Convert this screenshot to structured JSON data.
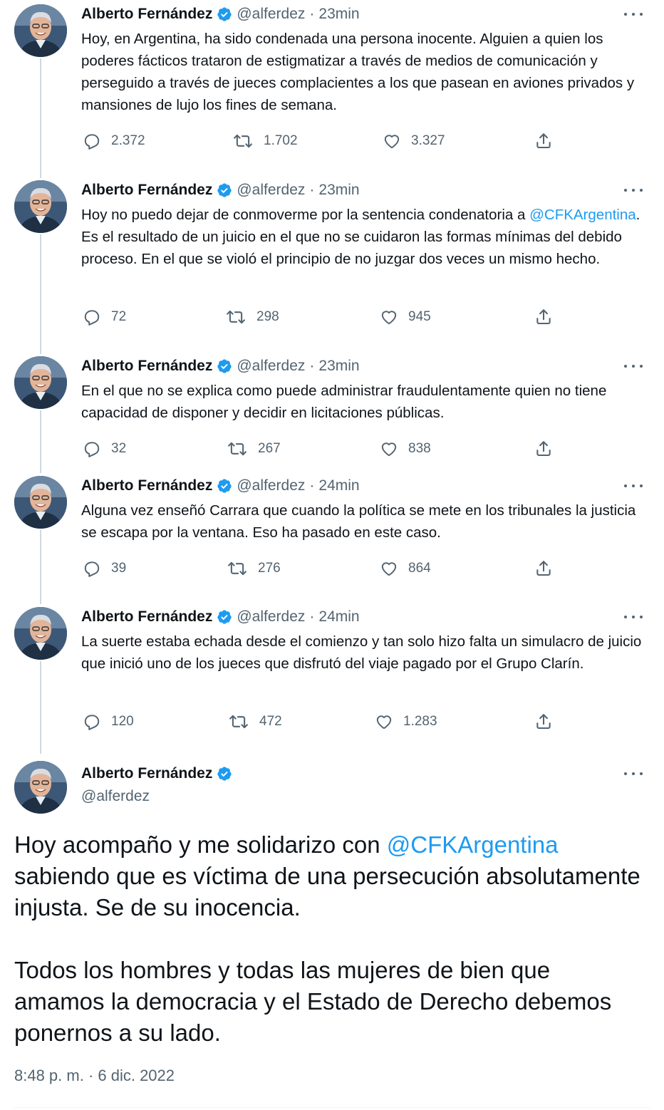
{
  "author": {
    "name": "Alberto Fernández",
    "handle": "@alferdez",
    "verified": true,
    "badge_color": "#1d9bf0"
  },
  "colors": {
    "link": "#1d9bf0",
    "muted": "#536471",
    "text": "#0f1419"
  },
  "icons": [
    "reply-icon",
    "retweet-icon",
    "like-icon",
    "share-icon",
    "more-icon",
    "verified-badge-icon"
  ],
  "thread": [
    {
      "time": "23min",
      "text_parts": [
        "Hoy, en Argentina, ha sido condenada una persona inocente. Alguien a quien los poderes fácticos trataron de estigmatizar a través de medios de comunicación y perseguido a través de jueces complacientes a los que pasean en aviones privados y mansiones de lujo los fines de semana."
      ],
      "replies": "2.372",
      "retweets": "1.702",
      "likes": "3.327"
    },
    {
      "time": "23min",
      "text_before": "Hoy no puedo dejar de conmoverme por la sentencia condenatoria a ",
      "mention": "@CFKArgentina",
      "text_after": ". Es el resultado de un juicio en el que no se cuidaron las formas mínimas del debido proceso. En el que se violó el principio de no juzgar dos veces un mismo hecho.",
      "replies": "72",
      "retweets": "298",
      "likes": "945"
    },
    {
      "time": "23min",
      "text_parts": [
        "En el que no se explica como puede administrar fraudulentamente quien no tiene capacidad de disponer y decidir en licitaciones públicas."
      ],
      "replies": "32",
      "retweets": "267",
      "likes": "838"
    },
    {
      "time": "24min",
      "text_parts": [
        "Alguna vez enseñó Carrara que cuando la política se mete en los tribunales la justicia se escapa por la ventana. Eso ha pasado en este caso."
      ],
      "replies": "39",
      "retweets": "276",
      "likes": "864"
    },
    {
      "time": "24min",
      "text_parts": [
        "La suerte estaba echada desde el comienzo y tan solo hizo falta un simulacro de juicio que inició uno de los jueces que disfrutó del viaje pagado por el Grupo Clarín."
      ],
      "replies": "120",
      "retweets": "472",
      "likes": "1.283"
    }
  ],
  "main_tweet": {
    "p1_before": "Hoy acompaño y me solidarizo con ",
    "p1_mention": "@CFKArgentina",
    "p1_after": " sabiendo que es víctima de una persecución absolutamente injusta. Se de su inocencia.",
    "p2": "Todos los hombres y todas las mujeres de bien que amamos la democracia y el Estado de Derecho debemos ponernos a su lado.",
    "timestamp": "8:48 p. m. · 6 dic. 2022"
  }
}
